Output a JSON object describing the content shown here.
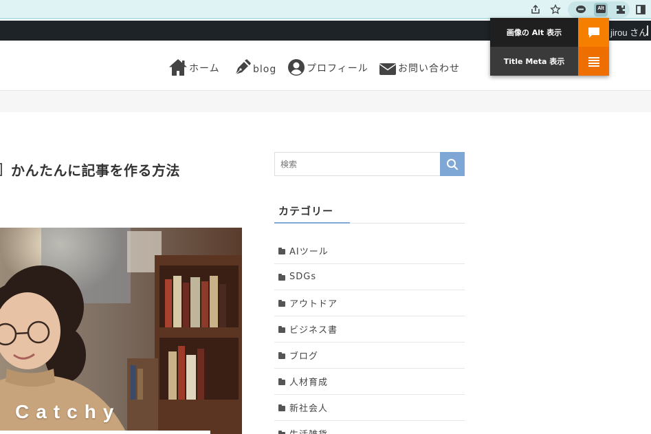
{
  "colors": {
    "browser_bar": "#dff3f4",
    "admin_bar": "#1d2327",
    "accent_blue": "#7fa7d6",
    "popup_orange_1": "#f77f00",
    "popup_orange_2": "#ee6f00",
    "popup_dark_1": "#1f1f1f",
    "popup_dark_2": "#3a3a3a"
  },
  "browser": {
    "icons": [
      "share-icon",
      "star-icon",
      "line-extension-icon",
      "alt-extension-icon",
      "puzzle-icon",
      "sidepanel-icon"
    ],
    "alt_badge": "Alt"
  },
  "admin_bar": {
    "user_greeting": "jirou さん"
  },
  "nav": {
    "items": [
      {
        "label": "ホーム",
        "icon": "home-icon"
      },
      {
        "label": "blog",
        "icon": "pen-icon"
      },
      {
        "label": "プロフィール",
        "icon": "user-circle-icon"
      },
      {
        "label": "お問い合わせ",
        "icon": "envelope-icon"
      }
    ]
  },
  "article": {
    "title": "かんたんに記事を作る方法",
    "hero_caption": "Catchy"
  },
  "sidebar": {
    "search_placeholder": "検索",
    "categories_heading": "カテゴリー",
    "categories": [
      "AIツール",
      "SDGs",
      "アウトドア",
      "ビジネス書",
      "ブログ",
      "人材育成",
      "新社会人",
      "生活雑貨"
    ]
  },
  "popup": {
    "alt_label": "画像の Alt 表示",
    "title_meta_label": "Title Meta 表示"
  }
}
